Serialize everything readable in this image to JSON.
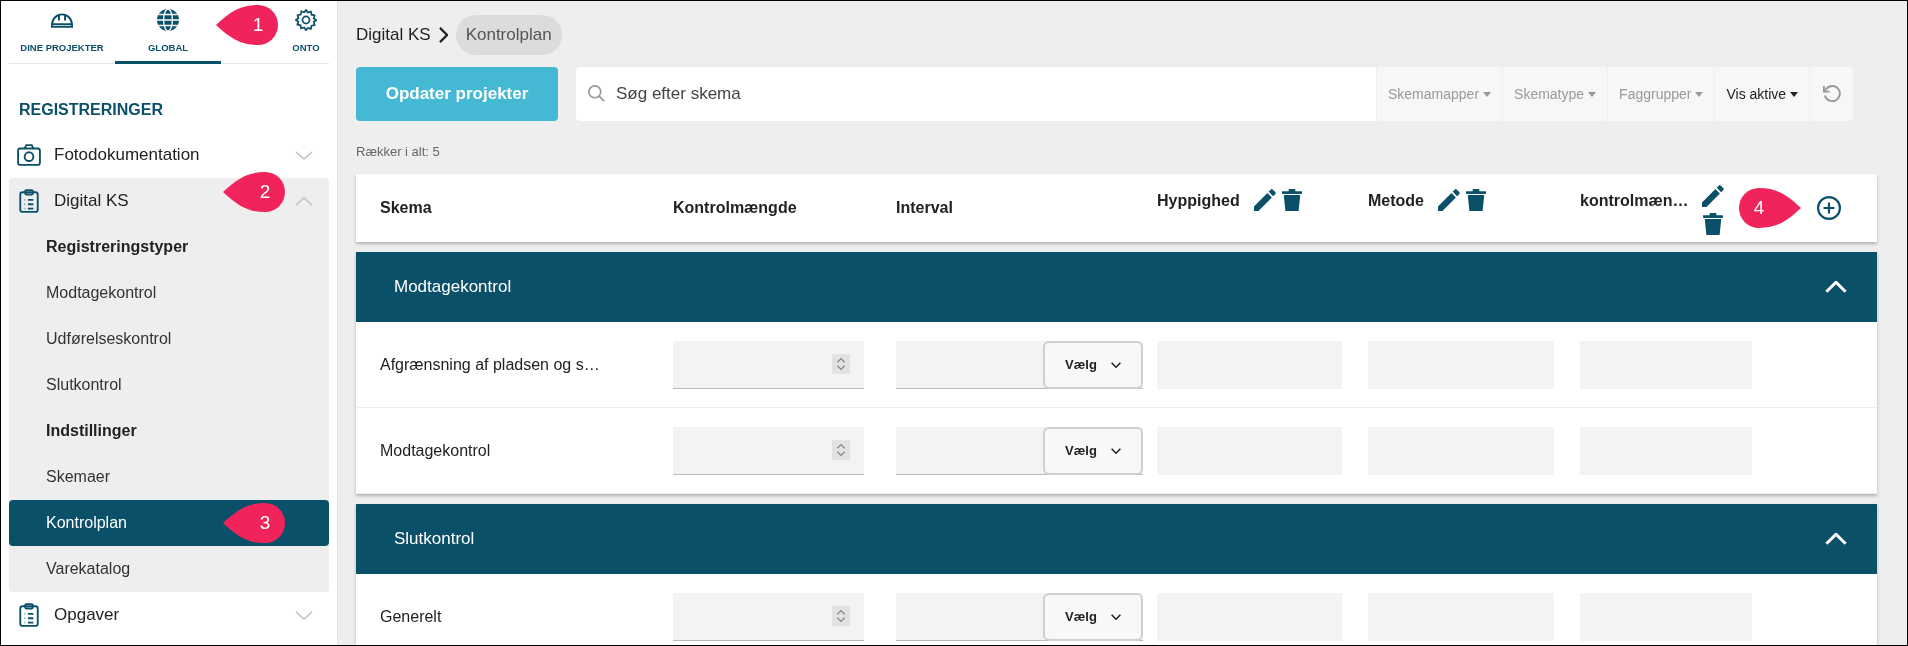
{
  "sidebar": {
    "tabs": [
      {
        "label": "DINE PROJEKTER",
        "selected": false
      },
      {
        "label": "GLOBAL",
        "selected": true,
        "callout": "1"
      },
      {
        "label": "ONTO",
        "selected": false
      }
    ],
    "section_title": "REGISTRERINGER",
    "items": [
      {
        "label": "Fotodokumentation",
        "expanded": false
      },
      {
        "label": "Digital KS",
        "expanded": true,
        "callout": "2",
        "children": [
          {
            "kind": "heading",
            "label": "Registreringstyper"
          },
          {
            "kind": "link",
            "label": "Modtagekontrol",
            "selected": false
          },
          {
            "kind": "link",
            "label": "Udførelseskontrol",
            "selected": false
          },
          {
            "kind": "link",
            "label": "Slutkontrol",
            "selected": false
          },
          {
            "kind": "heading",
            "label": "Indstillinger"
          },
          {
            "kind": "link",
            "label": "Skemaer",
            "selected": false
          },
          {
            "kind": "link",
            "label": "Kontrolplan",
            "selected": true,
            "callout": "3"
          },
          {
            "kind": "link",
            "label": "Varekatalog",
            "selected": false
          }
        ]
      },
      {
        "label": "Opgaver",
        "expanded": false
      }
    ]
  },
  "breadcrumb": [
    {
      "label": "Digital KS",
      "current": false
    },
    {
      "label": "Kontrolplan",
      "current": true
    }
  ],
  "toolbar": {
    "button": "Opdater projekter",
    "search": {
      "placeholder": "Søg efter skema"
    },
    "filters": [
      {
        "label": "Skemamapper",
        "active": false
      },
      {
        "label": "Skematype",
        "active": false
      },
      {
        "label": "Faggrupper",
        "active": false
      },
      {
        "label": "Vis aktive",
        "active": true
      }
    ]
  },
  "row_count": "Rækker i alt: 5",
  "table": {
    "columns": [
      {
        "label": "Skema",
        "actions": false
      },
      {
        "label": "Kontrolmængde",
        "actions": false
      },
      {
        "label": "Interval",
        "actions": false
      },
      {
        "label": "Hyppighed",
        "actions": true
      },
      {
        "label": "Metode",
        "actions": true
      },
      {
        "label": "kontrolmæn…",
        "actions": true
      }
    ],
    "add_callout": "4",
    "groups": [
      {
        "title": "Modtagekontrol",
        "expanded": true,
        "rows": [
          {
            "skema": "Afgrænsning af pladsen og s…",
            "interval_select": "Vælg"
          },
          {
            "skema": "Modtagekontrol",
            "interval_select": "Vælg"
          }
        ]
      },
      {
        "title": "Slutkontrol",
        "expanded": true,
        "rows": [
          {
            "skema": "Generelt",
            "interval_select": "Vælg"
          }
        ]
      }
    ]
  }
}
